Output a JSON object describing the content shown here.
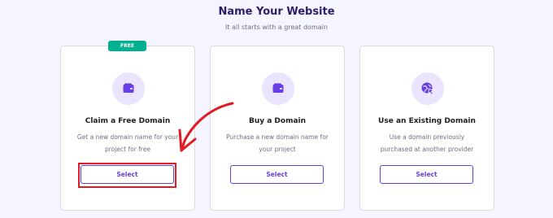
{
  "page": {
    "title": "Name Your Website",
    "subtitle": "It all starts with a great domain"
  },
  "cards": [
    {
      "badge": "FREE",
      "icon": "wallet-icon",
      "title": "Claim a Free Domain",
      "description": "Get a new domain name for your project for free",
      "button_label": "Select"
    },
    {
      "icon": "wallet-icon",
      "title": "Buy a Domain",
      "description": "Purchase a new domain name for your project",
      "button_label": "Select"
    },
    {
      "icon": "globe-cursor-icon",
      "title": "Use an Existing Domain",
      "description": "Use a domain previously purchased at another provider",
      "button_label": "Select"
    }
  ],
  "colors": {
    "background": "#f4f5ff",
    "accent": "#673de6",
    "badge": "#00b090",
    "annotation": "#e01b24"
  }
}
